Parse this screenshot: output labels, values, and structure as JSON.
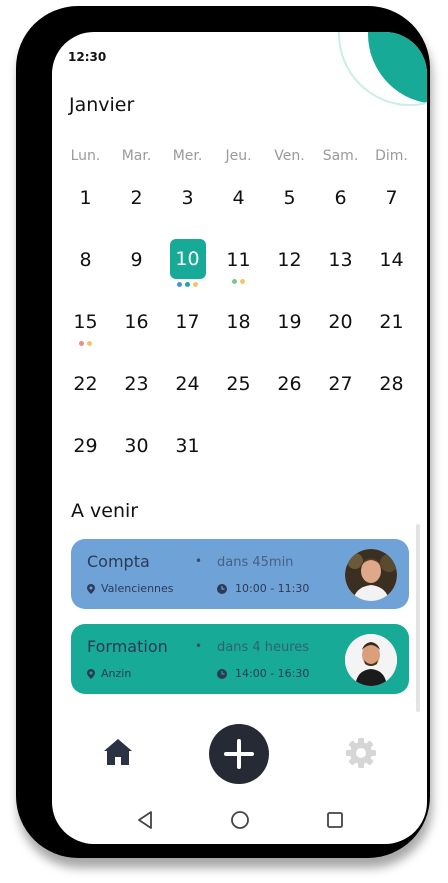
{
  "status": {
    "time": "12:30"
  },
  "calendar": {
    "month": "Janvier",
    "weekdays": [
      "Lun.",
      "Mar.",
      "Mer.",
      "Jeu.",
      "Ven.",
      "Sam.",
      "Dim."
    ],
    "days": [
      {
        "n": "1"
      },
      {
        "n": "2"
      },
      {
        "n": "3"
      },
      {
        "n": "4"
      },
      {
        "n": "5"
      },
      {
        "n": "6"
      },
      {
        "n": "7"
      },
      {
        "n": "8"
      },
      {
        "n": "9"
      },
      {
        "n": "10",
        "selected": true,
        "dots": [
          "#4a90d9",
          "#16aa97",
          "#f3c56a"
        ]
      },
      {
        "n": "11",
        "dots": [
          "#7fc48a",
          "#f3c56a"
        ]
      },
      {
        "n": "12"
      },
      {
        "n": "13"
      },
      {
        "n": "14"
      },
      {
        "n": "15",
        "dots": [
          "#f08a8a",
          "#f3c56a"
        ]
      },
      {
        "n": "16"
      },
      {
        "n": "17"
      },
      {
        "n": "18"
      },
      {
        "n": "19"
      },
      {
        "n": "20"
      },
      {
        "n": "21"
      },
      {
        "n": "22"
      },
      {
        "n": "23"
      },
      {
        "n": "24"
      },
      {
        "n": "25"
      },
      {
        "n": "26"
      },
      {
        "n": "27"
      },
      {
        "n": "28"
      },
      {
        "n": "29"
      },
      {
        "n": "30"
      },
      {
        "n": "31"
      }
    ]
  },
  "upcoming": {
    "title": "A venir",
    "events": [
      {
        "title": "Compta",
        "sep": "•",
        "when": "dans 45min",
        "location": "Valenciennes",
        "time": "10:00 - 11:30",
        "color": "#6fa3d8"
      },
      {
        "title": "Formation",
        "sep": "•",
        "when": "dans 4 heures",
        "location": "Anzin",
        "time": "14:00 - 16:30",
        "color": "#16aa97"
      }
    ]
  },
  "nav": {
    "home_icon": "home-icon",
    "add_icon": "plus-icon",
    "settings_icon": "gear-icon"
  },
  "colors": {
    "accent": "#16aa97",
    "dark": "#252a35"
  }
}
